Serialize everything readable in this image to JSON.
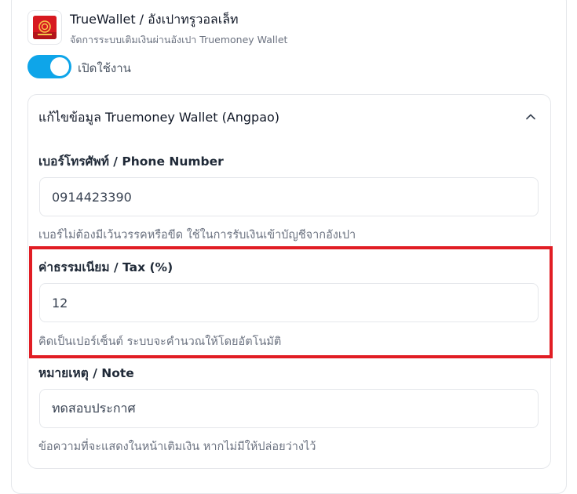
{
  "header": {
    "title": "TrueWallet / อังเปาทรูวอลเล็ท",
    "subtitle": "จัดการระบบเติมเงินผ่านอังเปา Truemoney Wallet",
    "logo_icon": "truewallet-logo-icon",
    "brand_color": "#d71920"
  },
  "toggle": {
    "label": "เปิดใช้งาน",
    "enabled": true,
    "color": "#0ea5e9"
  },
  "section": {
    "title": "แก้ไขข้อมูล Truemoney Wallet (Angpao)",
    "expanded": true,
    "chevron_icon": "chevron-up-icon"
  },
  "fields": [
    {
      "label": "เบอร์โทรศัพท์ / Phone Number",
      "value": "0914423390",
      "help": "เบอร์ไม่ต้องมีเว้นวรรคหรือขีด ใช้ในการรับเงินเข้าบัญชีจากอังเปา"
    },
    {
      "label": "ค่าธรรมเนียม / Tax (%)",
      "value": "12",
      "help": "คิดเป็นเปอร์เซ็นต์ ระบบจะคำนวณให้โดยอัตโนมัติ"
    },
    {
      "label": "หมายเหตุ / Note",
      "value": "ทดสอบประกาศ",
      "help": "ข้อความที่จะแสดงในหน้าเติมเงิน หากไม่มีให้ปล่อยว่างไว้"
    }
  ],
  "highlight_color": "#e11d24"
}
